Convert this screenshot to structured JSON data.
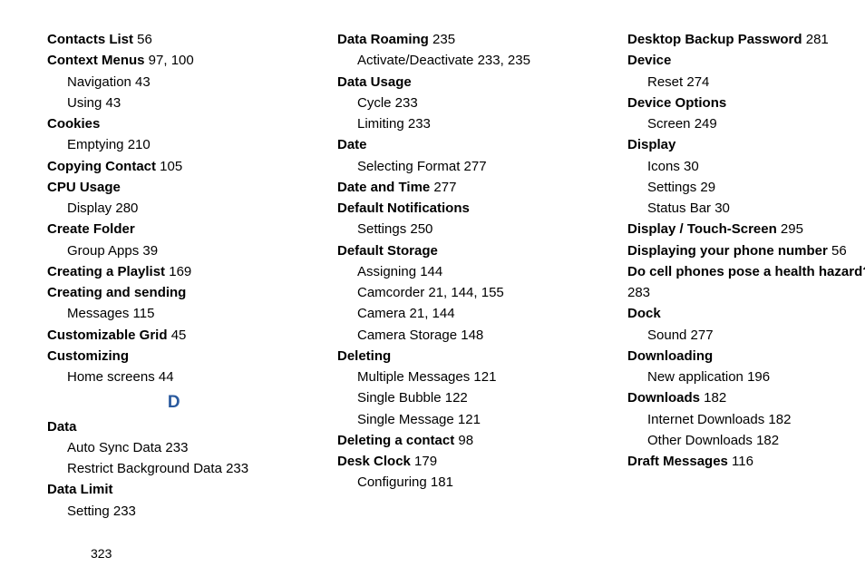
{
  "page_number": "323",
  "section_letter": "D",
  "columns": [
    [
      {
        "type": "main",
        "label": "Contacts List",
        "pages": " 56"
      },
      {
        "type": "main",
        "label": "Context Menus",
        "pages": " 97, 100"
      },
      {
        "type": "sub",
        "label": "Navigation",
        "pages": " 43"
      },
      {
        "type": "sub",
        "label": "Using",
        "pages": " 43"
      },
      {
        "type": "main",
        "label": "Cookies",
        "pages": ""
      },
      {
        "type": "sub",
        "label": "Emptying",
        "pages": " 210"
      },
      {
        "type": "main",
        "label": "Copying Contact",
        "pages": " 105"
      },
      {
        "type": "main",
        "label": "CPU Usage",
        "pages": ""
      },
      {
        "type": "sub",
        "label": "Display",
        "pages": " 280"
      },
      {
        "type": "main",
        "label": "Create Folder",
        "pages": ""
      },
      {
        "type": "sub",
        "label": "Group Apps",
        "pages": " 39"
      },
      {
        "type": "main",
        "label": "Creating a Playlist",
        "pages": " 169"
      },
      {
        "type": "main",
        "label": "Creating and sending",
        "pages": ""
      },
      {
        "type": "sub",
        "label": "Messages",
        "pages": " 115"
      },
      {
        "type": "main",
        "label": "Customizable Grid",
        "pages": " 45"
      },
      {
        "type": "main",
        "label": "Customizing",
        "pages": ""
      },
      {
        "type": "sub",
        "label": "Home screens",
        "pages": " 44"
      },
      {
        "type": "letter"
      },
      {
        "type": "main",
        "label": "Data",
        "pages": ""
      },
      {
        "type": "sub",
        "label": "Auto Sync Data",
        "pages": " 233"
      },
      {
        "type": "sub",
        "label": "Restrict Background Data",
        "pages": " 233"
      },
      {
        "type": "main",
        "label": "Data Limit",
        "pages": ""
      },
      {
        "type": "sub",
        "label": "Setting",
        "pages": " 233"
      }
    ],
    [
      {
        "type": "main",
        "label": "Data Roaming",
        "pages": " 235"
      },
      {
        "type": "sub",
        "label": "Activate/Deactivate",
        "pages": " 233, 235"
      },
      {
        "type": "main",
        "label": "Data Usage",
        "pages": ""
      },
      {
        "type": "sub",
        "label": "Cycle",
        "pages": " 233"
      },
      {
        "type": "sub",
        "label": "Limiting",
        "pages": " 233"
      },
      {
        "type": "main",
        "label": "Date",
        "pages": ""
      },
      {
        "type": "sub",
        "label": "Selecting Format",
        "pages": " 277"
      },
      {
        "type": "main",
        "label": "Date and Time",
        "pages": " 277"
      },
      {
        "type": "main",
        "label": "Default Notifications",
        "pages": ""
      },
      {
        "type": "sub",
        "label": "Settings",
        "pages": " 250"
      },
      {
        "type": "main",
        "label": "Default Storage",
        "pages": ""
      },
      {
        "type": "sub",
        "label": "Assigning",
        "pages": " 144"
      },
      {
        "type": "sub",
        "label": "Camcorder",
        "pages": " 21, 144, 155"
      },
      {
        "type": "sub",
        "label": "Camera",
        "pages": " 21, 144"
      },
      {
        "type": "sub",
        "label": "Camera Storage",
        "pages": " 148"
      },
      {
        "type": "main",
        "label": "Deleting",
        "pages": ""
      },
      {
        "type": "sub",
        "label": "Multiple Messages",
        "pages": " 121"
      },
      {
        "type": "sub",
        "label": "Single Bubble",
        "pages": " 122"
      },
      {
        "type": "sub",
        "label": "Single Message",
        "pages": " 121"
      },
      {
        "type": "main",
        "label": "Deleting a contact",
        "pages": " 98"
      },
      {
        "type": "main",
        "label": "Desk Clock",
        "pages": " 179"
      },
      {
        "type": "sub",
        "label": "Configuring",
        "pages": " 181"
      }
    ],
    [
      {
        "type": "main",
        "label": "Desktop Backup Password",
        "pages": " 281"
      },
      {
        "type": "main",
        "label": "Device",
        "pages": ""
      },
      {
        "type": "sub",
        "label": "Reset",
        "pages": " 274"
      },
      {
        "type": "main",
        "label": "Device Options",
        "pages": ""
      },
      {
        "type": "sub",
        "label": "Screen",
        "pages": " 249"
      },
      {
        "type": "main",
        "label": "Display",
        "pages": ""
      },
      {
        "type": "sub",
        "label": "Icons",
        "pages": " 30"
      },
      {
        "type": "sub",
        "label": "Settings",
        "pages": " 29"
      },
      {
        "type": "sub",
        "label": "Status Bar",
        "pages": " 30"
      },
      {
        "type": "main",
        "label": "Display / Touch-Screen",
        "pages": " 295"
      },
      {
        "type": "main",
        "label": "Displaying your phone number",
        "pages": " 56"
      },
      {
        "type": "main",
        "label": "Do cell phones pose a health hazard?",
        "pages": " 283",
        "wrap": true
      },
      {
        "type": "main",
        "label": "Dock",
        "pages": ""
      },
      {
        "type": "sub",
        "label": "Sound",
        "pages": " 277"
      },
      {
        "type": "main",
        "label": "Downloading",
        "pages": ""
      },
      {
        "type": "sub",
        "label": "New application",
        "pages": " 196"
      },
      {
        "type": "main",
        "label": "Downloads",
        "pages": " 182"
      },
      {
        "type": "sub",
        "label": "Internet Downloads",
        "pages": " 182"
      },
      {
        "type": "sub",
        "label": "Other Downloads",
        "pages": " 182"
      },
      {
        "type": "main",
        "label": "Draft Messages",
        "pages": " 116"
      }
    ]
  ]
}
